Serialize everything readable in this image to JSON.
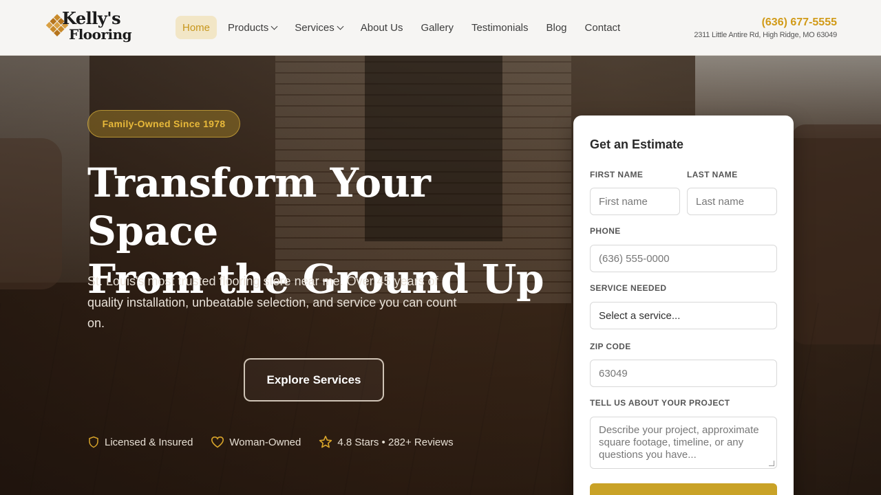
{
  "brand": {
    "name_line1": "Kelly's",
    "name_line2": "Flooring"
  },
  "nav": {
    "items": [
      {
        "label": "Home",
        "active": true,
        "has_dropdown": false
      },
      {
        "label": "Products",
        "active": false,
        "has_dropdown": true
      },
      {
        "label": "Services",
        "active": false,
        "has_dropdown": true
      },
      {
        "label": "About Us",
        "active": false,
        "has_dropdown": false
      },
      {
        "label": "Gallery",
        "active": false,
        "has_dropdown": false
      },
      {
        "label": "Testimonials",
        "active": false,
        "has_dropdown": false
      },
      {
        "label": "Blog",
        "active": false,
        "has_dropdown": false
      },
      {
        "label": "Contact",
        "active": false,
        "has_dropdown": false
      }
    ]
  },
  "contact": {
    "phone": "(636) 677-5555",
    "address": "2311 Little Antire Rd, High Ridge, MO 63049"
  },
  "hero": {
    "badge": "Family-Owned Since 1978",
    "title_line1": "Transform Your Space",
    "title_line2": "From the Ground Up",
    "subtitle": "St. Louis's most trusted flooring store near me. Over 45 years of quality installation, unbeatable selection, and service you can count on.",
    "cta": "Explore Services",
    "trust": [
      {
        "icon": "shield-icon",
        "label": "Licensed & Insured"
      },
      {
        "icon": "heart-icon",
        "label": "Woman-Owned"
      },
      {
        "icon": "star-icon",
        "label": "4.8 Stars • 282+ Reviews"
      }
    ]
  },
  "form": {
    "title": "Get an Estimate",
    "first_name": {
      "label": "FIRST NAME",
      "placeholder": "First name"
    },
    "last_name": {
      "label": "LAST NAME",
      "placeholder": "Last name"
    },
    "phone": {
      "label": "PHONE",
      "placeholder": "(636) 555-0000"
    },
    "service": {
      "label": "SERVICE NEEDED",
      "value": "Select a service..."
    },
    "zip": {
      "label": "ZIP CODE",
      "placeholder": "63049"
    },
    "project": {
      "label": "TELL US ABOUT YOUR PROJECT",
      "placeholder": "Describe your project, approximate square footage, timeline, or any questions you have..."
    }
  },
  "colors": {
    "accent": "#d19a17",
    "header_bg": "#f6f5f3",
    "active_nav_bg": "#f2e6c6"
  }
}
